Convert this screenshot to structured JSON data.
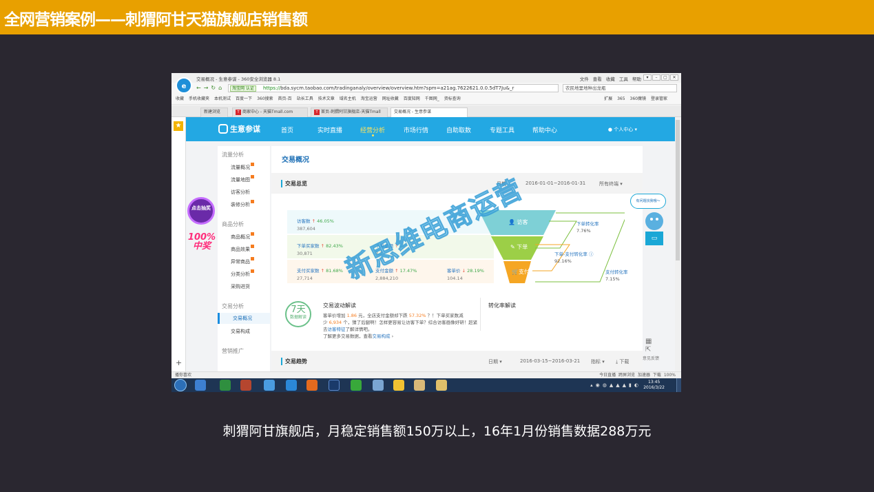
{
  "slide": {
    "title": "全网营销案例——刺猬阿甘天猫旗舰店销售额",
    "caption": "刺猬阿甘旗舰店，月稳定销售额150万以上，16年1月份销售数据288万元",
    "colors": {
      "header": "#e8a000",
      "background": "#2a2730"
    }
  },
  "browser": {
    "window_title": "交易概况 - 生意参谋 - 360安全浏览器 8.1",
    "menu": [
      "文件",
      "查看",
      "收藏",
      "工具",
      "帮助"
    ],
    "url_tag": "淘宝网 认证",
    "url_scheme": "https://",
    "url_host": "bda.sycm.taobao.com",
    "url_path": "/tradinganaly/overview/overview.htm?spm=a21ag.7622621.0.0.5dT7Ju&_r",
    "search_text": "农民地里地种出龙瓶",
    "favorites": [
      "收藏",
      "手机收藏夹",
      "本机测试",
      "百度一下",
      "360搜索",
      "首页-百",
      "站长工具",
      "技术文章",
      "域名主机",
      "淘宝运营",
      "网址收藏",
      "百度知网",
      "千图网_",
      "资标查询"
    ],
    "favorites_right": [
      "扩展",
      "365",
      "360魔镜",
      "登录管家"
    ],
    "tabs": [
      {
        "label": "新建浏览"
      },
      {
        "label": "商家中心 - 天猫Tmall.com"
      },
      {
        "label": "首页-刺猬阿甘旗舰店-天猫Tmall"
      },
      {
        "label": "交易概况 - 生意参谋"
      }
    ],
    "statusbar_left": "播你喜欢",
    "statusbar_right": [
      "今日直播",
      "跨屏浏览",
      "加速器",
      "下载",
      "100%"
    ]
  },
  "sycm": {
    "logo": "生意参谋",
    "nav": [
      "首页",
      "实时直播",
      "经营分析",
      "市场行情",
      "自助取数",
      "专题工具",
      "帮助中心"
    ],
    "user": "个人中心",
    "side_menu": {
      "groups": [
        {
          "head": "流量分析",
          "items": [
            "流量概况",
            "流量地图",
            "访客分析",
            "装修分析"
          ]
        },
        {
          "head": "商品分析",
          "items": [
            "商品概况",
            "商品效果",
            "异常商品",
            "分类分析",
            "采购进货"
          ]
        },
        {
          "head": "交易分析",
          "items": [
            "交易概况",
            "交易构成"
          ]
        },
        {
          "head": "营销推广",
          "items": []
        }
      ]
    },
    "promo": {
      "circle": "点击抽奖",
      "text": "100%中奖"
    },
    "content": {
      "title": "交易概况",
      "overview": {
        "title": "交易总览",
        "date_label": "日期",
        "date_range": "2016-01-01~2016-01-31",
        "terminal": "所有终端"
      },
      "metrics": [
        {
          "label": "访客数",
          "arrow": "↑",
          "pct": "46.05%",
          "value": "387,604"
        },
        {
          "label": "下单买家数",
          "arrow": "↑",
          "pct": "82.43%",
          "value": "30,871"
        },
        {
          "label": "下单金额",
          "arrow": "↑",
          "pct": "—",
          "value": "3,2"
        },
        {
          "label": "支付买家数",
          "arrow": "↑",
          "pct": "81.68%",
          "value": "27,714"
        },
        {
          "label": "支付金额",
          "arrow": "↑",
          "pct": "17.47%",
          "value": "2,884,210"
        },
        {
          "label": "客单价",
          "arrow": "↓",
          "pct": "28.19%",
          "value": "104.14"
        }
      ],
      "funnel": [
        "访客",
        "下单",
        "支付"
      ],
      "rates": [
        {
          "label": "下单转化率",
          "value": "7.76%"
        },
        {
          "label": "下单-支付转化率",
          "value": "92.16%"
        },
        {
          "label": "支付转化率",
          "value": "7.15%"
        }
      ],
      "interp": {
        "badge_num": "7天",
        "badge_text": "数据解读",
        "head": "交易波动解读",
        "line1_a": "客单价增加",
        "line1_b": "1.86",
        "line1_c": "元，全店支付金额却下跌",
        "line1_d": "57.32%",
        "line1_e": "？！下单买家数减",
        "line2_a": "少",
        "line2_b": "6,934",
        "line2_c": "个，猜了后腿啊！怎样更容易让访客下单？综合访客画像好研！赶紧",
        "line3_a": "去",
        "line3_b": "访客特征",
        "line3_c": "了解详情吧。",
        "line4_a": "了解更多交易数据，查看",
        "line4_b": "交易构成",
        "conv_head": "转化率解读"
      },
      "trend": {
        "title": "交易趋势",
        "date_label": "日期",
        "date_range": "2016-03-15~2016-03-21",
        "index": "指标",
        "download": "下载"
      }
    },
    "assistant": {
      "bubble": "有问题找我哦～",
      "feedback": "意见反馈"
    }
  },
  "watermark": "新思维电商运营",
  "taskbar": {
    "time": "13:45",
    "date": "2016/3/22"
  }
}
